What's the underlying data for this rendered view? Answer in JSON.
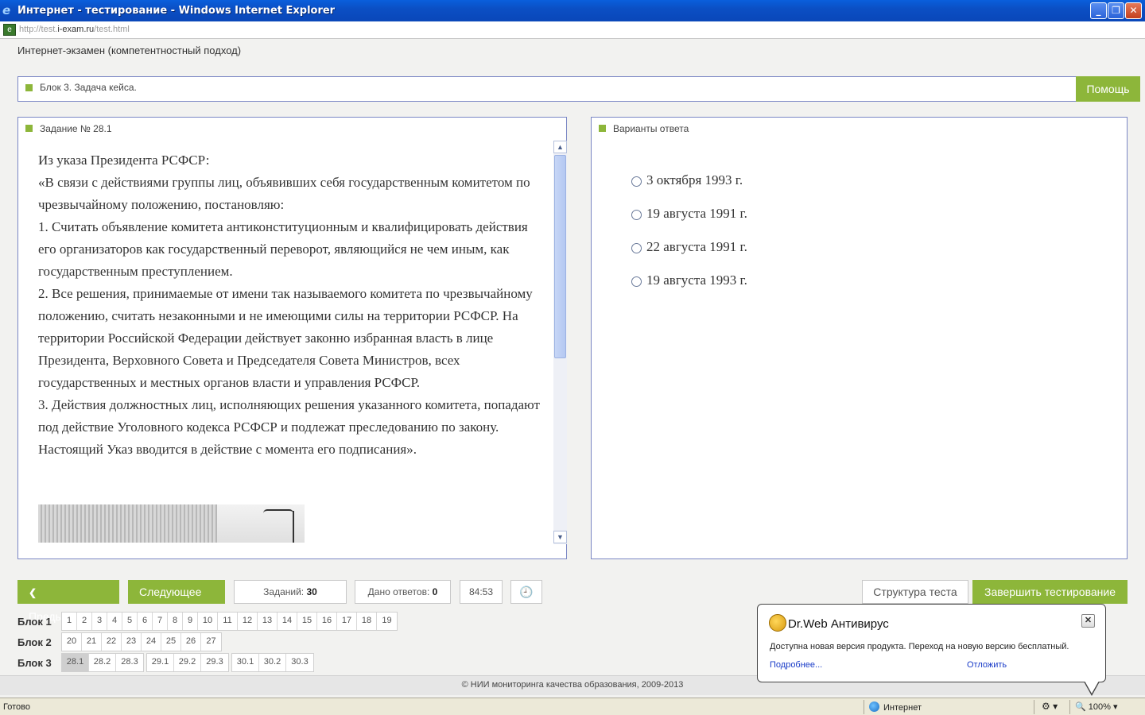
{
  "window": {
    "title": "Интернет - тестирование - Windows Internet Explorer",
    "url_prefix": "http://test.",
    "url_domain": "i-exam.ru",
    "url_suffix": "/test.html"
  },
  "header": {
    "page_title": "Интернет-экзамен (компетентностный подход)",
    "block_label": "Блок 3. Задача кейса.",
    "help_label": "Помощь"
  },
  "task": {
    "heading": "Задание № 28.1",
    "paragraphs": [
      "Из указа Президента РСФСР:",
      "«В связи с действиями группы лиц, объявивших себя государственным комитетом по чрезвычайному положению, постановляю:",
      "1. Считать объявление комитета антиконституционным и квалифицировать действия его организаторов как государственный переворот, являющийся не чем иным, как государственным преступлением.",
      "2. Все решения, принимаемые от имени так называемого комитета по чрезвычайному положению, считать незаконными и не имеющими силы на территории РСФСР. На территории Российской Федерации действует законно избранная власть в лице Президента, Верховного Совета и Председателя Совета Министров, всех государственных и местных органов власти и управления РСФСР.",
      "3. Действия должностных лиц, исполняющих решения указанного комитета, попадают под действие Уголовного кодекса РСФСР и подлежат преследованию по закону.",
      "Настоящий Указ вводится в действие с момента его подписания»."
    ]
  },
  "answers": {
    "heading": "Варианты ответа",
    "options": [
      "3 октября 1993 г.",
      "19 августа 1991 г.",
      "22 августа 1991 г.",
      "19 августа 1993 г."
    ]
  },
  "nav": {
    "prev_label": "Предыдущее",
    "next_label": "Следующее",
    "tasks_label": "Заданий:",
    "tasks_count": "30",
    "answered_label": "Дано ответов:",
    "answered_count": "0",
    "timer": "84:53",
    "structure_label": "Структура теста",
    "finish_label": "Завершить тестирование"
  },
  "blocks": [
    {
      "label": "Блок 1",
      "groups": [
        [
          "1",
          "2",
          "3",
          "4",
          "5",
          "6",
          "7",
          "8",
          "9",
          "10",
          "11",
          "12",
          "13",
          "14",
          "15",
          "16",
          "17",
          "18",
          "19"
        ]
      ]
    },
    {
      "label": "Блок 2",
      "groups": [
        [
          "20",
          "21",
          "22",
          "23",
          "24",
          "25",
          "26",
          "27"
        ]
      ]
    },
    {
      "label": "Блок 3",
      "groups": [
        [
          "28.1",
          "28.2",
          "28.3"
        ],
        [
          "29.1",
          "29.2",
          "29.3"
        ],
        [
          "30.1",
          "30.2",
          "30.3"
        ]
      ]
    }
  ],
  "active_cell": "28.1",
  "footer": {
    "copyright": "© НИИ мониторинга качества образования, 2009-2013"
  },
  "statusbar": {
    "status": "Готово",
    "zone": "Интернет",
    "zoom": "100%"
  },
  "popup": {
    "title": "Dr.Web Антивирус",
    "message": "Доступна новая версия продукта. Переход на новую версию бесплатный.",
    "more_link": "Подробнее...",
    "later_link": "Отложить"
  },
  "colors": {
    "accent": "#8db63a",
    "panel_border": "#7a86c4",
    "titlebar": "#0b4fc4"
  }
}
